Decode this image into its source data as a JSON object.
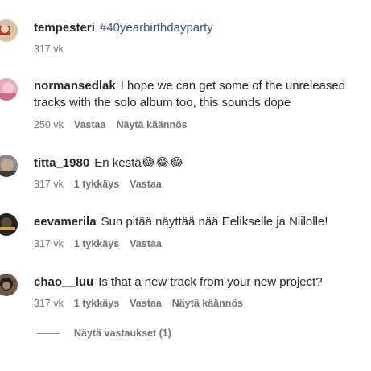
{
  "comments": [
    {
      "username": "tempesteri",
      "text": "",
      "hashtag": "#40yearbirthdayparty",
      "time": "317 vk",
      "likes": "",
      "reply": "",
      "translate": ""
    },
    {
      "username": "normansedlak",
      "text": "I hope we can get some of the unreleased tracks with the solo album too, this sounds dope",
      "hashtag": "",
      "time": "250 vk",
      "likes": "",
      "reply": "Vastaa",
      "translate": "Näytä käännös"
    },
    {
      "username": "titta_1980",
      "text": "En kestä😂😂😂",
      "hashtag": "",
      "time": "317 vk",
      "likes": "1 tykkäys",
      "reply": "Vastaa",
      "translate": ""
    },
    {
      "username": "eevamerila",
      "text": "Sun pitää näyttää nää Eelikselle ja Niilolle!",
      "hashtag": "",
      "time": "317 vk",
      "likes": "1 tykkäys",
      "reply": "Vastaa",
      "translate": ""
    },
    {
      "username": "chao__luu",
      "text": "Is that a new track from your new project?",
      "hashtag": "",
      "time": "317 vk",
      "likes": "1 tykkäys",
      "reply": "Vastaa",
      "translate": "Näytä käännös"
    }
  ],
  "view_replies": "Näytä vastaukset (1)",
  "colors": {
    "text": "#262626",
    "meta": "#737373",
    "hashtag": "#385185"
  }
}
